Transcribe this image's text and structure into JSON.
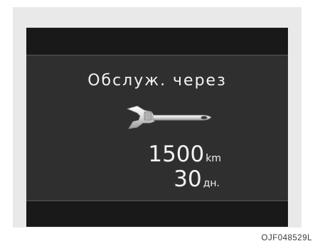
{
  "display": {
    "title": "Обслуж. через",
    "icon": "wrench-icon",
    "distance_value": "1500",
    "distance_unit": "km",
    "days_value": "30",
    "days_unit": "дн."
  },
  "figure_code": "OJF048529L",
  "colors": {
    "screen_bg": "#2f2f2f",
    "bar_bg": "#191919",
    "frame_bg": "#e9e9e9",
    "text": "#f2f2f2"
  }
}
